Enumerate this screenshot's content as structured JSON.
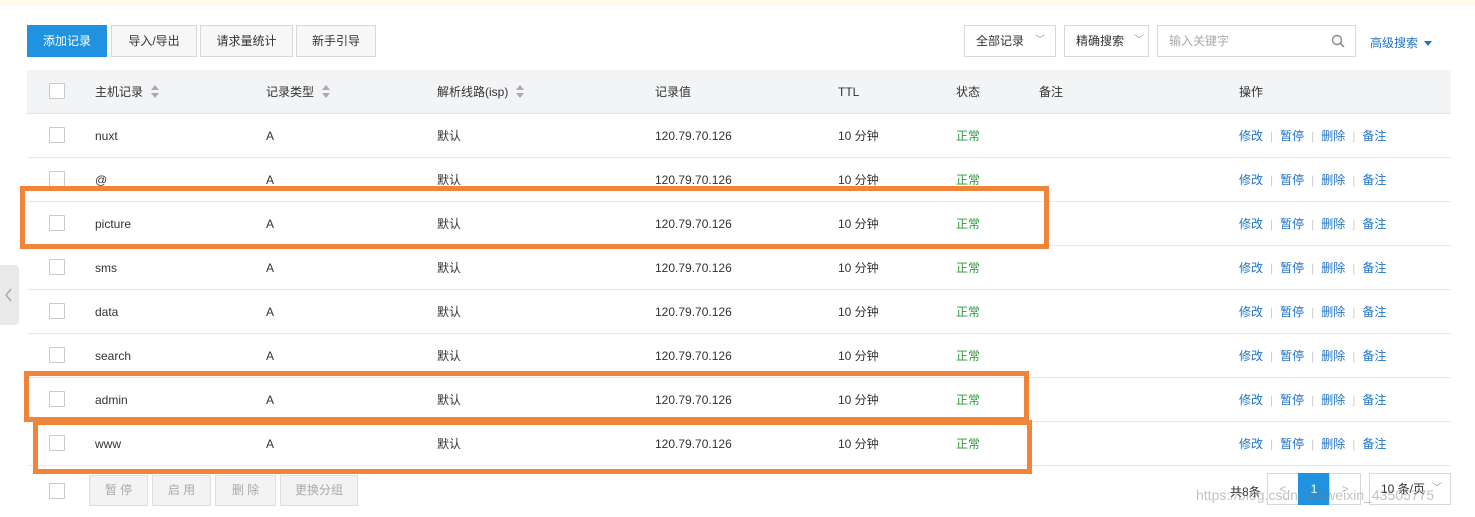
{
  "toolbar": {
    "add_label": "添加记录",
    "import_export_label": "导入/导出",
    "stats_label": "请求量统计",
    "guide_label": "新手引导",
    "filter_all": "全部记录",
    "filter_exact": "精确搜索",
    "search_placeholder": "输入关键字",
    "advanced_label": "高级搜索"
  },
  "table": {
    "headers": {
      "host": "主机记录",
      "type": "记录类型",
      "line": "解析线路(isp)",
      "value": "记录值",
      "ttl": "TTL",
      "status": "状态",
      "note": "备注",
      "ops": "操作"
    },
    "rows": [
      {
        "host": "nuxt",
        "type": "A",
        "line": "默认",
        "value": "120.79.70.126",
        "ttl": "10 分钟",
        "status": "正常"
      },
      {
        "host": "@",
        "type": "A",
        "line": "默认",
        "value": "120.79.70.126",
        "ttl": "10 分钟",
        "status": "正常"
      },
      {
        "host": "picture",
        "type": "A",
        "line": "默认",
        "value": "120.79.70.126",
        "ttl": "10 分钟",
        "status": "正常"
      },
      {
        "host": "sms",
        "type": "A",
        "line": "默认",
        "value": "120.79.70.126",
        "ttl": "10 分钟",
        "status": "正常"
      },
      {
        "host": "data",
        "type": "A",
        "line": "默认",
        "value": "120.79.70.126",
        "ttl": "10 分钟",
        "status": "正常"
      },
      {
        "host": "search",
        "type": "A",
        "line": "默认",
        "value": "120.79.70.126",
        "ttl": "10 分钟",
        "status": "正常"
      },
      {
        "host": "admin",
        "type": "A",
        "line": "默认",
        "value": "120.79.70.126",
        "ttl": "10 分钟",
        "status": "正常"
      },
      {
        "host": "www",
        "type": "A",
        "line": "默认",
        "value": "120.79.70.126",
        "ttl": "10 分钟",
        "status": "正常"
      }
    ],
    "ops": {
      "edit": "修改",
      "pause": "暂停",
      "delete": "删除",
      "note": "备注"
    }
  },
  "footer": {
    "pause": "暂 停",
    "enable": "启 用",
    "delete": "删 除",
    "change_group": "更换分组",
    "total": "共8条",
    "current_page": "1",
    "page_size": "10 条/页",
    "watermark": "https://blog.csdn.net/weixin_43505775"
  },
  "colors": {
    "primary": "#1f92e0",
    "link": "#1f73c8",
    "status_ok": "#2b9b3a",
    "highlight": "#f0843a"
  }
}
